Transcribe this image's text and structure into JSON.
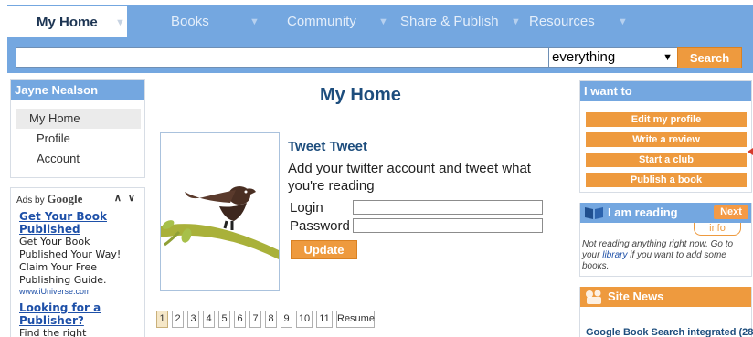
{
  "nav": {
    "tabs": [
      {
        "label": "My Home",
        "active": true
      },
      {
        "label": "Books"
      },
      {
        "label": "Community"
      },
      {
        "label": "Share & Publish"
      },
      {
        "label": "Resources"
      }
    ]
  },
  "search": {
    "query": "",
    "scope": "everything",
    "button": "Search"
  },
  "left_panel": {
    "user": "Jayne Nealson",
    "items": [
      "My Home",
      "Profile",
      "Account"
    ]
  },
  "ads": {
    "label_prefix": "Ads by",
    "brand": "Google",
    "nav": "∧ ∨",
    "items": [
      {
        "title_line1": "Get Your Book",
        "title_line2": "Published",
        "text": [
          "Get Your Book",
          "Published Your Way!",
          "Claim Your Free",
          "Publishing Guide."
        ],
        "url": "www.iUniverse.com"
      },
      {
        "title_line1": "Looking for a",
        "title_line2": "Publisher?",
        "text": [
          "Find the right"
        ]
      }
    ]
  },
  "main": {
    "title": "My Home",
    "tweet": {
      "title": "Tweet Tweet",
      "desc_line1": "Add your twitter account and tweet what",
      "desc_line2": "you're reading",
      "login_label": "Login",
      "password_label": "Password",
      "update_button": "Update"
    },
    "pager": {
      "pages": [
        "1",
        "2",
        "3",
        "4",
        "5",
        "6",
        "7",
        "8",
        "9",
        "10",
        "11"
      ],
      "current": "1",
      "resume": "Resume"
    }
  },
  "right": {
    "want": {
      "title": "I want to",
      "actions": [
        "Edit my profile",
        "Write a review",
        "Start a club",
        "Publish a book"
      ]
    },
    "reading": {
      "title": "I am reading",
      "next": "Next",
      "info": "info",
      "text_before": "Not reading anything right now. Go to your ",
      "link": "library",
      "text_after": " if you want to add some books."
    },
    "news": {
      "title": "Site News",
      "item": "Google Book Search integrated (28"
    }
  }
}
